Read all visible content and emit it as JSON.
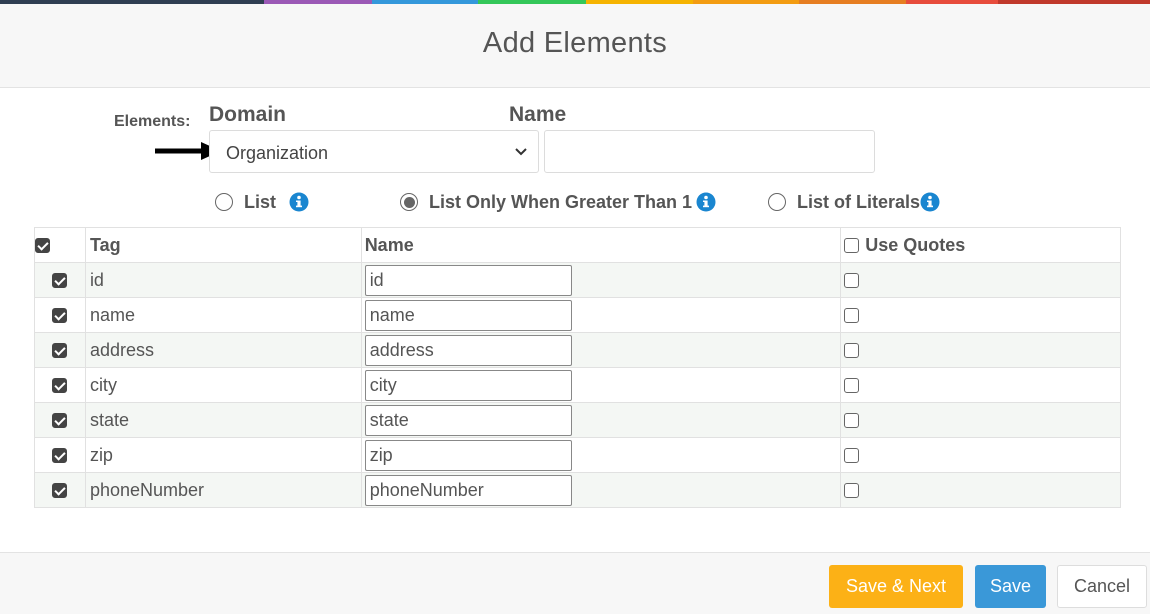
{
  "colors": {
    "topbar": [
      "#2f3e52",
      "#9b59b6",
      "#3498db",
      "#34c759",
      "#f5b300",
      "#f39c12",
      "#e67e22",
      "#e74c3c",
      "#c0392b"
    ],
    "accent_save_next": "#fcb116",
    "accent_save": "#3a98d8"
  },
  "dialog": {
    "title": "Add Elements"
  },
  "form": {
    "elements_label": "Elements:",
    "domain_label": "Domain",
    "name_label": "Name",
    "domain_value": "Organization",
    "name_value": ""
  },
  "list_options": {
    "list_label": "List",
    "list_gt1_label": "List Only When Greater Than 1",
    "list_literals_label": "List of Literals",
    "selected": "list_gt1"
  },
  "table": {
    "headers": {
      "tag": "Tag",
      "name": "Name",
      "use_quotes": "Use Quotes"
    },
    "header_checked": true,
    "use_quotes_all_checked": false,
    "rows": [
      {
        "checked": true,
        "tag": "id",
        "name": "id",
        "use_quotes": false
      },
      {
        "checked": true,
        "tag": "name",
        "name": "name",
        "use_quotes": false
      },
      {
        "checked": true,
        "tag": "address",
        "name": "address",
        "use_quotes": false
      },
      {
        "checked": true,
        "tag": "city",
        "name": "city",
        "use_quotes": false
      },
      {
        "checked": true,
        "tag": "state",
        "name": "state",
        "use_quotes": false
      },
      {
        "checked": true,
        "tag": "zip",
        "name": "zip",
        "use_quotes": false
      },
      {
        "checked": true,
        "tag": "phoneNumber",
        "name": "phoneNumber",
        "use_quotes": false
      }
    ]
  },
  "footer": {
    "save_next_label": "Save & Next",
    "save_label": "Save",
    "cancel_label": "Cancel"
  }
}
